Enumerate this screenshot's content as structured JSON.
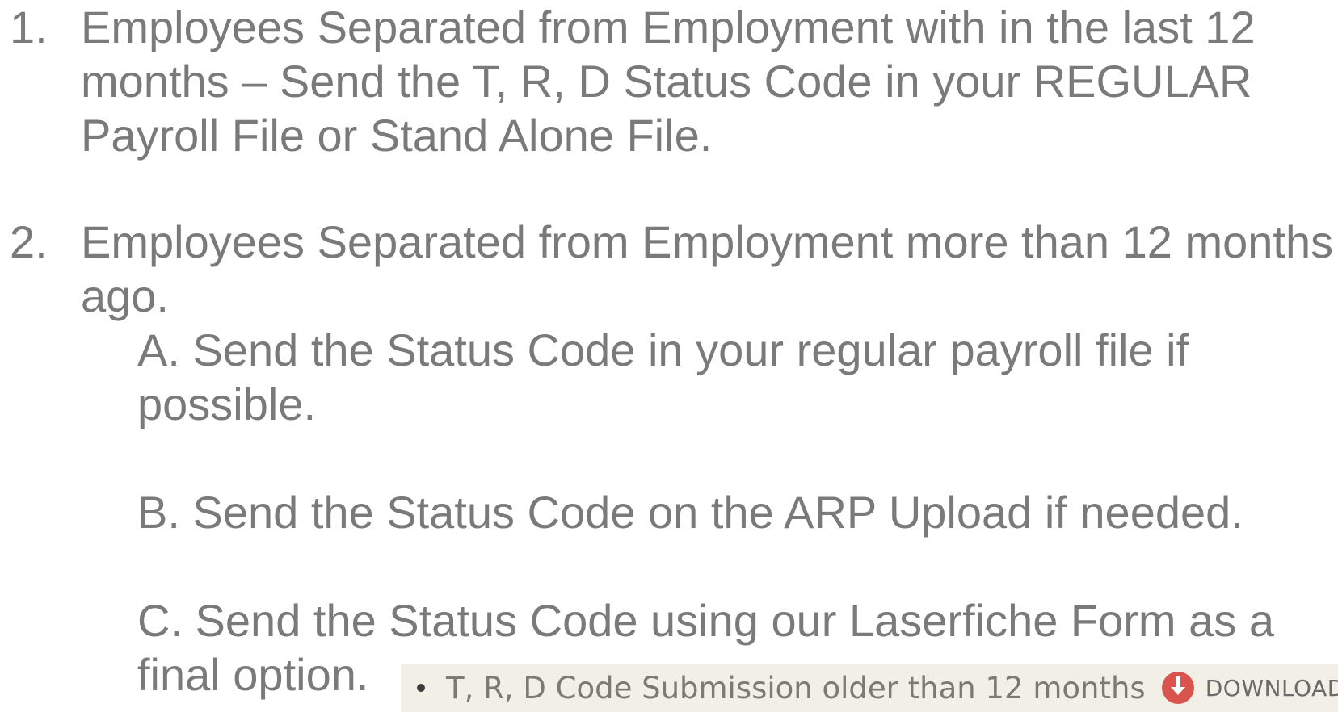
{
  "items": [
    {
      "number": "1.",
      "lines": [
        "Employees Separated from Employment with in the last 12",
        "months – Send the T, R, D Status Code in your REGULAR",
        "Payroll File or Stand Alone File."
      ]
    },
    {
      "number": "2.",
      "lines": [
        "Employees Separated from Employment more than 12 months",
        "ago."
      ],
      "subitems": [
        {
          "lines": [
            "A. Send the Status Code in your regular payroll file if",
            "possible."
          ]
        },
        {
          "lines": [
            "B. Send the Status Code on the ARP Upload if needed."
          ]
        },
        {
          "lines": [
            "C. Send the Status Code using our Laserfiche Form as a",
            "final option."
          ]
        }
      ]
    }
  ],
  "callout": {
    "text": "T, R, D Code Submission older than 12 months",
    "download_label": "DOWNLOAD",
    "icon": "download-icon",
    "icon_color": "#d9534f"
  }
}
